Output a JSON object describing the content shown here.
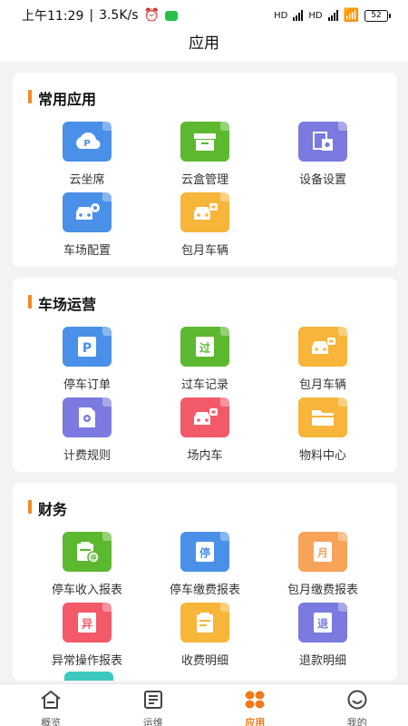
{
  "status": {
    "time": "上午11:29",
    "speed": "3.5K/s",
    "battery": "52",
    "net1": "HD",
    "net2": "HD"
  },
  "header": {
    "title": "应用"
  },
  "sections": [
    {
      "title": "常用应用",
      "items": [
        {
          "label": "云坐席",
          "icon": "cloud-parking-icon",
          "glyph": "P",
          "color": "#4a90e8"
        },
        {
          "label": "云盒管理",
          "icon": "box-icon",
          "glyph": "",
          "color": "#5cb82e"
        },
        {
          "label": "设备设置",
          "icon": "device-settings-icon",
          "glyph": "⚙",
          "color": "#7a7ae0"
        },
        {
          "label": "车场配置",
          "icon": "car-settings-icon",
          "glyph": "🚘",
          "color": "#4a90e8"
        },
        {
          "label": "包月车辆",
          "icon": "monthly-car-icon",
          "glyph": "🚘",
          "color": "#f7b53a"
        }
      ]
    },
    {
      "title": "车场运营",
      "items": [
        {
          "label": "停车订单",
          "icon": "parking-order-icon",
          "glyph": "P",
          "color": "#4a90e8"
        },
        {
          "label": "过车记录",
          "icon": "pass-record-icon",
          "glyph": "过",
          "color": "#5cb82e"
        },
        {
          "label": "包月车辆",
          "icon": "monthly-car-icon",
          "glyph": "🚘",
          "color": "#f7b53a"
        },
        {
          "label": "计费规则",
          "icon": "billing-rule-icon",
          "glyph": "⚙",
          "color": "#7a7ae0"
        },
        {
          "label": "场内车",
          "icon": "in-lot-car-icon",
          "glyph": "🚘",
          "color": "#f25a6a"
        },
        {
          "label": "物料中心",
          "icon": "folder-icon",
          "glyph": "",
          "color": "#f7b53a"
        }
      ]
    },
    {
      "title": "财务",
      "items": [
        {
          "label": "停车收入报表",
          "icon": "parking-income-icon",
          "glyph": "停",
          "color": "#5cb82e"
        },
        {
          "label": "停车缴费报表",
          "icon": "parking-payment-icon",
          "glyph": "停",
          "color": "#4a90e8"
        },
        {
          "label": "包月缴费报表",
          "icon": "monthly-payment-icon",
          "glyph": "月",
          "color": "#f8a35a"
        },
        {
          "label": "异常操作报表",
          "icon": "abnormal-report-icon",
          "glyph": "异",
          "color": "#f25a6a"
        },
        {
          "label": "收费明细",
          "icon": "charge-detail-icon",
          "glyph": "",
          "color": "#f7b53a"
        },
        {
          "label": "退款明细",
          "icon": "refund-detail-icon",
          "glyph": "退",
          "color": "#7a7ae0"
        }
      ]
    }
  ],
  "tabs": [
    {
      "label": "概览",
      "icon": "home-icon"
    },
    {
      "label": "运维",
      "icon": "list-icon"
    },
    {
      "label": "应用",
      "icon": "apps-icon",
      "active": true
    },
    {
      "label": "我的",
      "icon": "profile-icon"
    }
  ]
}
